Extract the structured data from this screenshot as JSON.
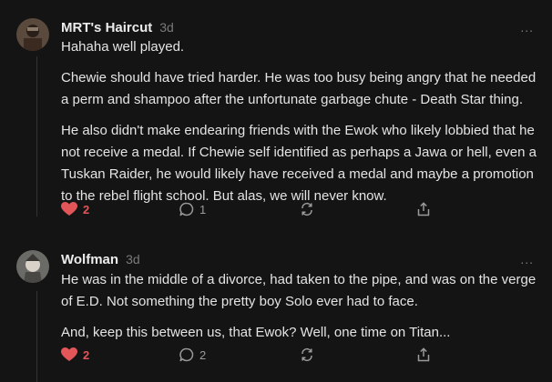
{
  "comments": [
    {
      "author": "MRT's Haircut",
      "time": "3d",
      "paragraphs": [
        "Hahaha well played.",
        "Chewie should have tried harder. He was too busy being angry that he needed a perm and shampoo after the unfortunate garbage chute - Death Star thing.",
        "He also didn't make endearing friends with the Ewok who likely lobbied that he not receive a medal. If Chewie self identified as perhaps a Jawa or hell, even a Tuskan Raider, he would likely have received a medal and maybe a promotion to the rebel flight school. But alas, we will never know."
      ],
      "likes": "2",
      "replies": "1",
      "icons": {
        "like": "heart-icon",
        "reply": "speech-bubble-icon",
        "restack": "restack-icon",
        "share": "share-icon"
      }
    },
    {
      "author": "Wolfman",
      "time": "3d",
      "paragraphs": [
        "He was in the middle of a divorce, had taken to the pipe, and was on the verge of E.D. Not something the pretty boy Solo ever had to face.",
        "And, keep this between us, that Ewok? Well, one time on Titan..."
      ],
      "likes": "2",
      "replies": "2",
      "icons": {
        "like": "heart-icon",
        "reply": "speech-bubble-icon",
        "restack": "restack-icon",
        "share": "share-icon"
      }
    }
  ],
  "more_label": "...",
  "colors": {
    "background": "#141414",
    "like": "#e25559",
    "muted": "#7a7a7a"
  }
}
